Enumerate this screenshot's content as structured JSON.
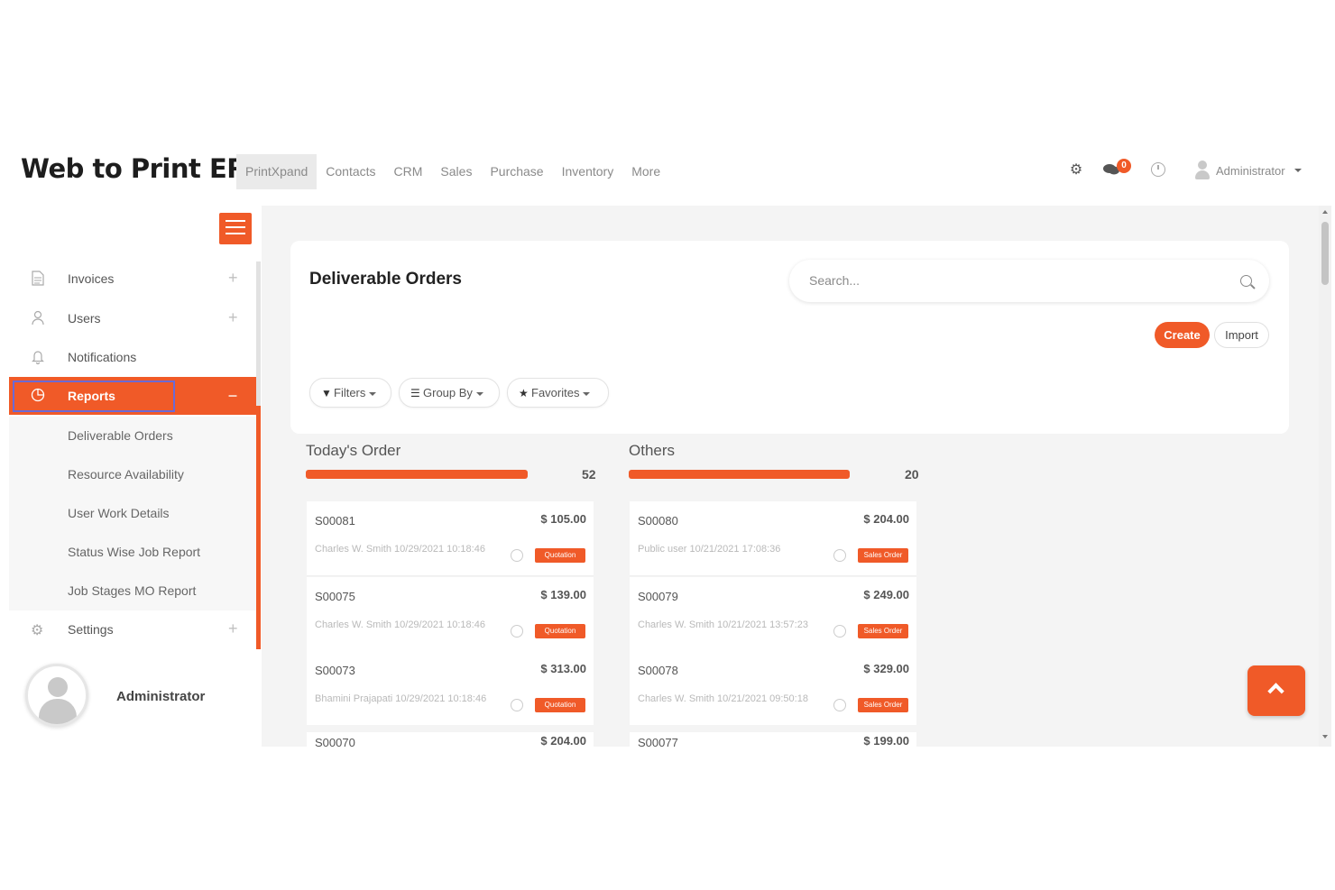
{
  "app": {
    "brand": "Web to Print ERP"
  },
  "topnav": {
    "items": [
      {
        "label": "PrintXpand",
        "active": true
      },
      {
        "label": "Contacts"
      },
      {
        "label": "CRM"
      },
      {
        "label": "Sales"
      },
      {
        "label": "Purchase"
      },
      {
        "label": "Inventory"
      },
      {
        "label": "More"
      }
    ],
    "messages_badge": "0",
    "user_label": "Administrator",
    "icons": [
      "gear-icon",
      "chat-icon",
      "clock-icon",
      "user-avatar-icon"
    ]
  },
  "sidebar": {
    "items": [
      {
        "label": "Invoices",
        "icon": "document-icon"
      },
      {
        "label": "Users",
        "icon": "user-icon"
      },
      {
        "label": "Notifications",
        "icon": "bell-icon"
      },
      {
        "label": "Reports",
        "icon": "pie-chart-icon",
        "active": true
      }
    ],
    "subitems": [
      {
        "label": "Deliverable Orders"
      },
      {
        "label": "Resource Availability"
      },
      {
        "label": "User Work Details"
      },
      {
        "label": "Status Wise Job Report"
      },
      {
        "label": "Job Stages MO Report"
      }
    ],
    "settings": {
      "label": "Settings",
      "icon": "gear-icon"
    },
    "profile_name": "Administrator"
  },
  "main": {
    "title": "Deliverable Orders",
    "search_placeholder": "Search...",
    "create_label": "Create",
    "import_label": "Import",
    "filters": [
      {
        "label": "Filters",
        "icon": "filter-icon"
      },
      {
        "label": "Group By",
        "icon": "list-icon"
      },
      {
        "label": "Favorites",
        "icon": "star-icon"
      }
    ],
    "accent_color": "#f05a28"
  },
  "columns": [
    {
      "title": "Today's Order",
      "count": "52",
      "orders": [
        {
          "id": "S00081",
          "amount": "$ 105.00",
          "meta": "Charles W. Smith 10/29/2021 10:18:46",
          "tag": "Quotation"
        },
        {
          "id": "S00075",
          "amount": "$ 139.00",
          "meta": "Charles W. Smith 10/29/2021 10:18:46",
          "tag": "Quotation"
        },
        {
          "id": "S00073",
          "amount": "$ 313.00",
          "meta": "Bhamini Prajapati 10/29/2021 10:18:46",
          "tag": "Quotation"
        },
        {
          "id": "S00070",
          "amount": "$ 204.00"
        }
      ]
    },
    {
      "title": "Others",
      "count": "20",
      "orders": [
        {
          "id": "S00080",
          "amount": "$ 204.00",
          "meta": "Public user 10/21/2021 17:08:36",
          "tag": "Sales Order"
        },
        {
          "id": "S00079",
          "amount": "$ 249.00",
          "meta": "Charles W. Smith 10/21/2021 13:57:23",
          "tag": "Sales Order"
        },
        {
          "id": "S00078",
          "amount": "$ 329.00",
          "meta": "Charles W. Smith 10/21/2021 09:50:18",
          "tag": "Sales Order"
        },
        {
          "id": "S00077",
          "amount": "$ 199.00"
        }
      ]
    }
  ]
}
